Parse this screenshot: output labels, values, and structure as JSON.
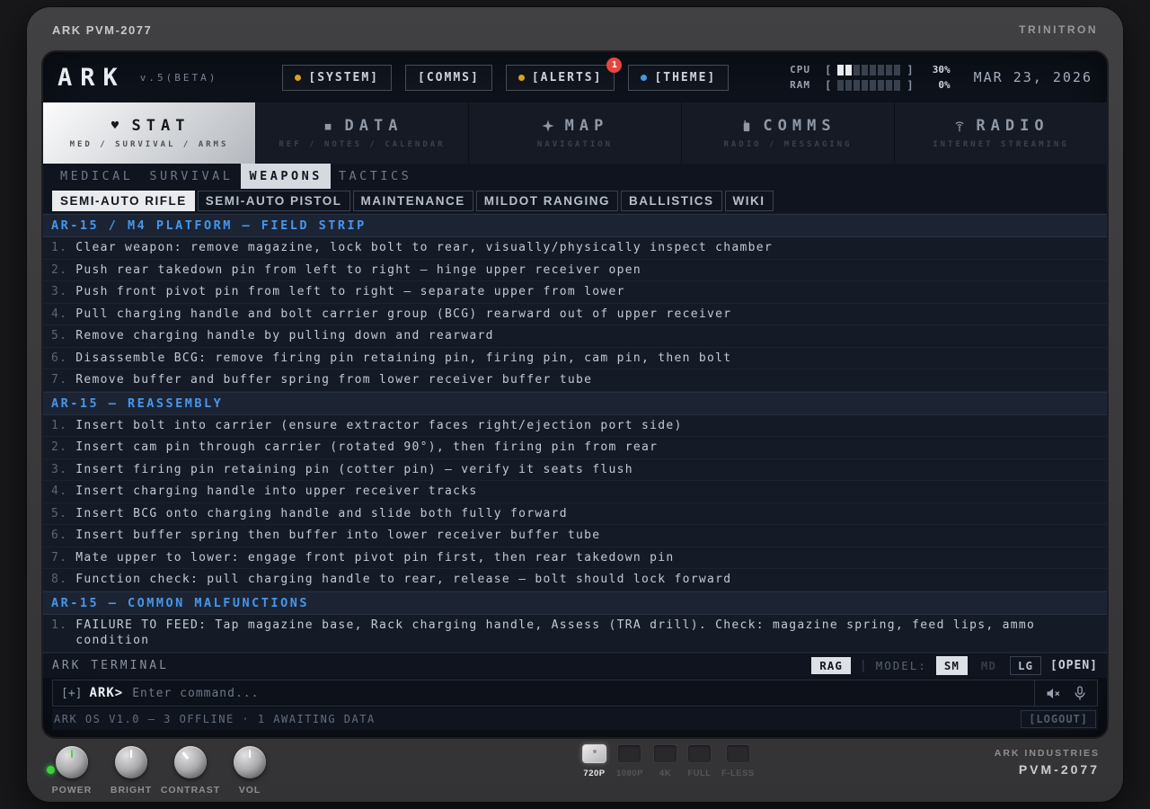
{
  "bezel": {
    "top_left": "ARK PVM-2077",
    "top_right": "TRINITRON",
    "brand_line1": "ARK INDUSTRIES",
    "brand_line2": "PVM-2077",
    "knobs": [
      {
        "label": "POWER",
        "pointer_color": "#4cd44c",
        "angle": 0
      },
      {
        "label": "BRIGHT",
        "pointer_color": "#ffffff",
        "angle": 0
      },
      {
        "label": "CONTRAST",
        "pointer_color": "#ffffff",
        "angle": -40
      },
      {
        "label": "VOL",
        "pointer_color": "#ffffff",
        "angle": 0
      }
    ],
    "res_buttons": [
      {
        "label": "720P",
        "active": true
      },
      {
        "label": "1080P",
        "active": false
      },
      {
        "label": "4K",
        "active": false
      },
      {
        "label": "FULL",
        "active": false
      },
      {
        "label": "F-LESS",
        "active": false
      }
    ]
  },
  "header": {
    "logo": "ARK",
    "version": "v.5(BETA)",
    "buttons": [
      {
        "label": "[SYSTEM]",
        "dot": "#d9a21b"
      },
      {
        "label": "[COMMS]"
      },
      {
        "label": "[ALERTS]",
        "dot": "#d9a21b",
        "badge": "1"
      },
      {
        "label": "[THEME]",
        "dot": "#4596e8"
      }
    ],
    "meters": [
      {
        "label": "CPU",
        "segments": 8,
        "filled": 2,
        "percent": "30%"
      },
      {
        "label": "RAM",
        "segments": 8,
        "filled": 0,
        "percent": "0%"
      }
    ],
    "date": "MAR 23, 2026"
  },
  "nav_tabs": [
    {
      "icon": "heart-icon",
      "label": "STAT",
      "sub": "MED / SURVIVAL / ARMS",
      "active": true
    },
    {
      "icon": "square-icon",
      "label": "DATA",
      "sub": "REF / NOTES / CALENDAR",
      "active": false
    },
    {
      "icon": "compass-icon",
      "label": "MAP",
      "sub": "NAVIGATION",
      "active": false
    },
    {
      "icon": "walkie-talkie-icon",
      "label": "COMMS",
      "sub": "RADIO / MESSAGING",
      "active": false
    },
    {
      "icon": "antenna-icon",
      "label": "RADIO",
      "sub": "INTERNET STREAMING",
      "active": false
    }
  ],
  "subnav": [
    {
      "label": "MEDICAL",
      "active": false
    },
    {
      "label": "SURVIVAL",
      "active": false
    },
    {
      "label": "WEAPONS",
      "active": true
    },
    {
      "label": "TACTICS",
      "active": false
    }
  ],
  "doc_tabs": [
    {
      "label": "SEMI-AUTO RIFLE",
      "active": true
    },
    {
      "label": "SEMI-AUTO PISTOL",
      "active": false
    },
    {
      "label": "MAINTENANCE",
      "active": false
    },
    {
      "label": "MILDOT RANGING",
      "active": false
    },
    {
      "label": "BALLISTICS",
      "active": false
    },
    {
      "label": "WIKI",
      "active": false
    }
  ],
  "sections": [
    {
      "title": "AR-15 / M4 PLATFORM — FIELD STRIP",
      "items": [
        "Clear weapon: remove magazine, lock bolt to rear, visually/physically inspect chamber",
        "Push rear takedown pin from left to right — hinge upper receiver open",
        "Push front pivot pin from left to right — separate upper from lower",
        "Pull charging handle and bolt carrier group (BCG) rearward out of upper receiver",
        "Remove charging handle by pulling down and rearward",
        "Disassemble BCG: remove firing pin retaining pin, firing pin, cam pin, then bolt",
        "Remove buffer and buffer spring from lower receiver buffer tube"
      ]
    },
    {
      "title": "AR-15 — REASSEMBLY",
      "items": [
        "Insert bolt into carrier (ensure extractor faces right/ejection port side)",
        "Insert cam pin through carrier (rotated 90°), then firing pin from rear",
        "Insert firing pin retaining pin (cotter pin) — verify it seats flush",
        "Insert charging handle into upper receiver tracks",
        "Insert BCG onto charging handle and slide both fully forward",
        "Insert buffer spring then buffer into lower receiver buffer tube",
        "Mate upper to lower: engage front pivot pin first, then rear takedown pin",
        "Function check: pull charging handle to rear, release — bolt should lock forward"
      ]
    },
    {
      "title": "AR-15 — COMMON MALFUNCTIONS",
      "items": [
        "FAILURE TO FEED: Tap magazine base, Rack charging handle, Assess (TRA drill). Check: magazine spring, feed lips, ammo condition"
      ]
    }
  ],
  "terminal": {
    "title": "ARK TERMINAL",
    "rag": "RAG",
    "separator": "|",
    "model_label": "MODEL:",
    "models": [
      {
        "label": "SM",
        "state": "active"
      },
      {
        "label": "MD",
        "state": "disabled"
      },
      {
        "label": "LG",
        "state": "outline"
      }
    ],
    "open": "[OPEN]",
    "prompt_prefix": "[+]",
    "prompt": "ARK>",
    "placeholder": "Enter command...",
    "icons": [
      "muted-speaker-icon",
      "microphone-icon"
    ],
    "status": "ARK OS V1.0 — 3 OFFLINE · 1 AWAITING DATA",
    "logout": "[LOGOUT]"
  },
  "colors": {
    "accent_blue": "#4796ea",
    "amber_dot": "#d9a21b",
    "badge_red": "#e8453f",
    "screen_bg": "#0d121b",
    "content_bg": "#141a26",
    "active_light": "#dde1e7"
  }
}
